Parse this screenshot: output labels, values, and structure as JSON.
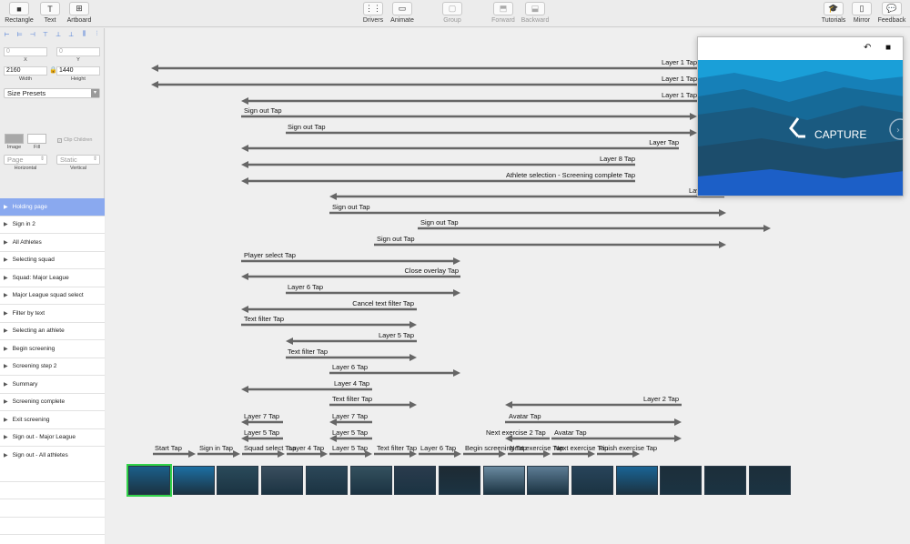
{
  "toolbar": {
    "left": [
      {
        "label": "Rectangle",
        "icon": "rectangle-icon"
      },
      {
        "label": "Text",
        "icon": "text-icon"
      },
      {
        "label": "Artboard",
        "icon": "artboard-icon"
      }
    ],
    "center": [
      {
        "label": "Drivers",
        "icon": "drivers-icon",
        "enabled": true
      },
      {
        "label": "Animate",
        "icon": "animate-icon",
        "enabled": true
      },
      {
        "label": "Group",
        "icon": "group-icon",
        "enabled": false
      },
      {
        "label": "Forward",
        "icon": "forward-icon",
        "enabled": false
      },
      {
        "label": "Backward",
        "icon": "backward-icon",
        "enabled": false
      }
    ],
    "right": [
      {
        "label": "Tutorials",
        "icon": "tutorials-icon"
      },
      {
        "label": "Mirror",
        "icon": "mirror-icon"
      },
      {
        "label": "Feedback",
        "icon": "feedback-icon"
      }
    ]
  },
  "inspector": {
    "x_value": "0",
    "x_label": "X",
    "y_value": "0",
    "y_label": "Y",
    "width_value": "2160",
    "width_label": "Width",
    "height_value": "1440",
    "height_label": "Height",
    "size_presets": "Size Presets",
    "image_label": "Image",
    "fill_label": "Fill",
    "clip_children": "Clip Children",
    "horizontal_value": "Page",
    "horizontal_label": "Horizontal",
    "vertical_value": "Static",
    "vertical_label": "Vertical"
  },
  "layers": [
    {
      "label": "Holding page",
      "selected": true
    },
    {
      "label": "Sign in 2",
      "selected": false
    },
    {
      "label": "All Athletes",
      "selected": false
    },
    {
      "label": "Selecting squad",
      "selected": false
    },
    {
      "label": "Squad: Major League",
      "selected": false
    },
    {
      "label": "Major League squad select",
      "selected": false
    },
    {
      "label": "Filter by text",
      "selected": false
    },
    {
      "label": "Selecting an athlete",
      "selected": false
    },
    {
      "label": "Begin screening",
      "selected": false
    },
    {
      "label": "Screening step 2",
      "selected": false
    },
    {
      "label": "Summary",
      "selected": false
    },
    {
      "label": "Screening complete",
      "selected": false
    },
    {
      "label": "Exit screening",
      "selected": false
    },
    {
      "label": "Sign out - Major League",
      "selected": false
    },
    {
      "label": "Sign out - All athletes",
      "selected": false
    }
  ],
  "canvas": {
    "arrow_labels": [
      "Layer 1 Tap",
      "Layer 1 Tap",
      "Layer 1 Tap",
      "Sign out Tap",
      "Sign out Tap",
      "Layer Tap",
      "Layer 8 Tap",
      "Athlete selection - Screening complete Tap",
      "Layer 1 Tap",
      "Sign out Tap",
      "Sign out Tap",
      "Sign out Tap",
      "Player select Tap",
      "Close overlay Tap",
      "Layer 6 Tap",
      "Cancel text filter Tap",
      "Text filter Tap",
      "Layer 5 Tap",
      "Text filter Tap",
      "Layer 6 Tap",
      "Layer 4 Tap",
      "Text filter Tap",
      "Layer 2 Tap",
      "Layer 7 Tap",
      "Layer 7 Tap",
      "Avatar Tap",
      "Layer 5 Tap",
      "Layer 5 Tap",
      "Next exercise 2 Tap",
      "Avatar Tap",
      "Start Tap",
      "Sign in Tap",
      "Squad select Tap",
      "Layer 4 Tap",
      "Layer 5 Tap",
      "Text filter Tap",
      "Layer 6 Tap",
      "Begin screening Tap",
      "Next exercise Tap",
      "Next exercise Tap",
      "Finish exercise Tap"
    ],
    "thumbnail_count": 15
  },
  "preview": {
    "logo_text": "CAPTURE"
  },
  "colors": {
    "selection": "#8aa9ef",
    "arrow": "#666666",
    "selected_thumb": "#32d34a",
    "preview_blue": "#1a9fd8"
  }
}
